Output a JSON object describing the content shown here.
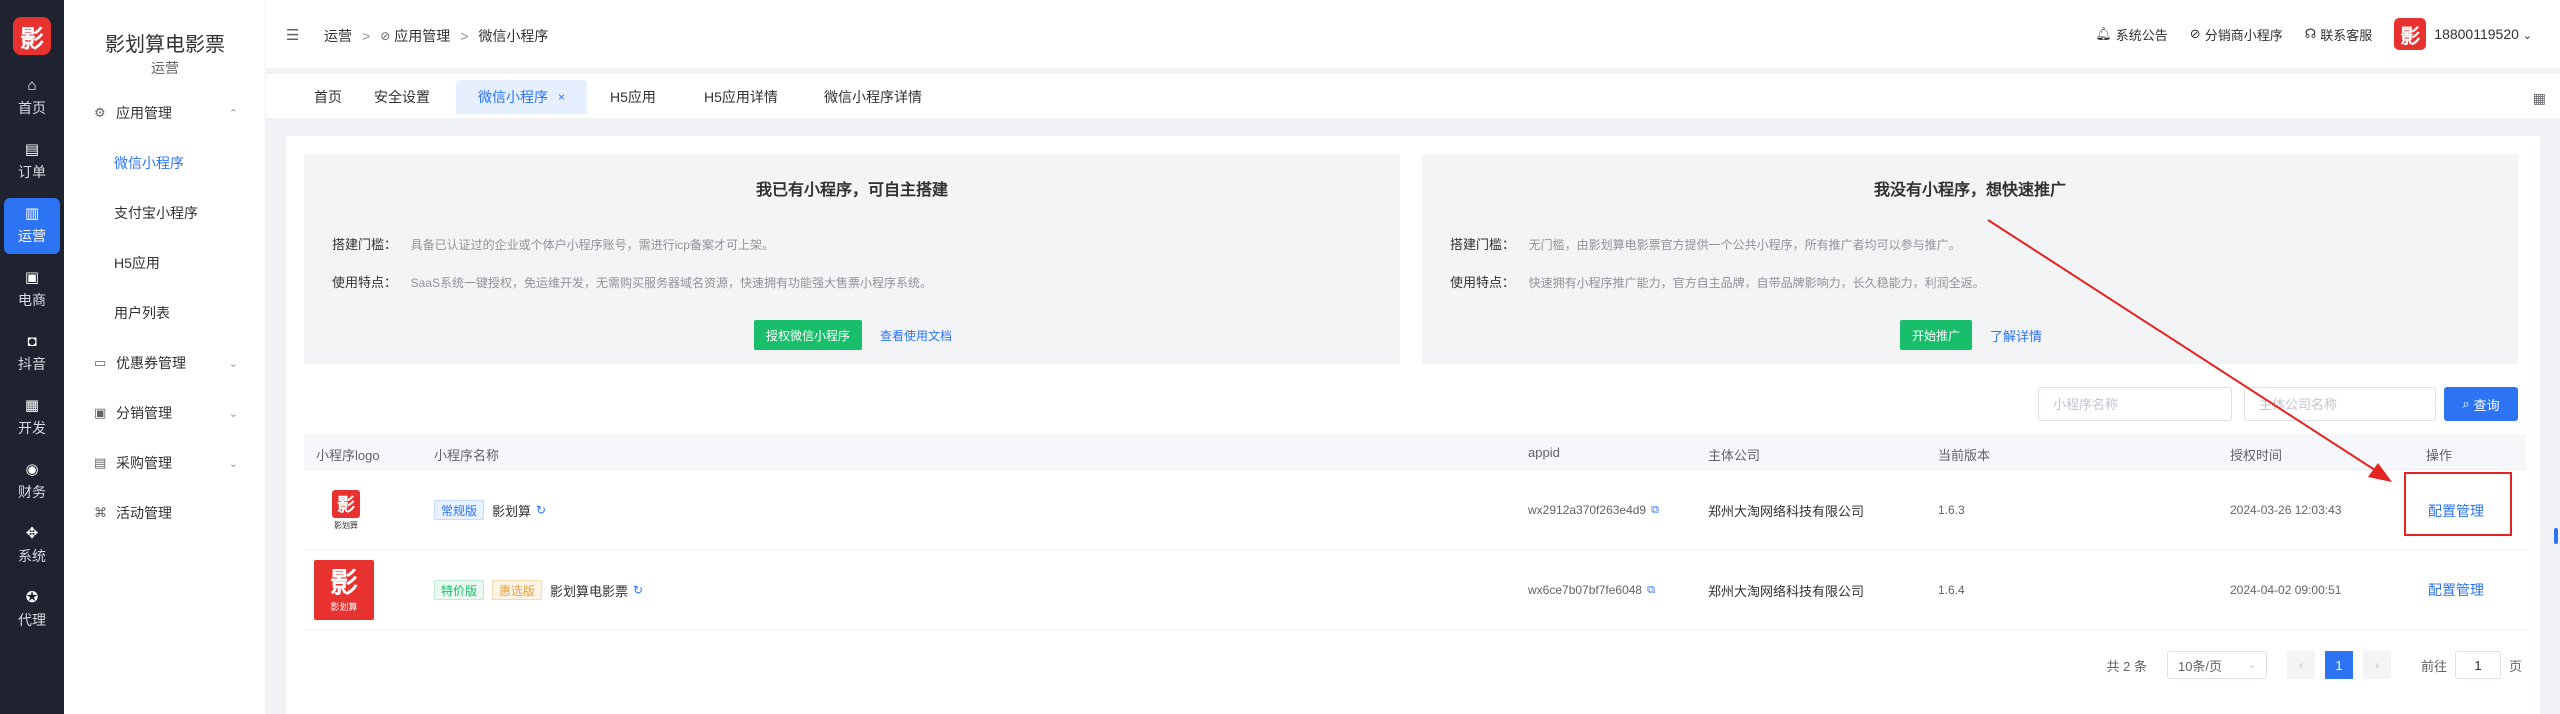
{
  "rail": {
    "logo": "影",
    "items": [
      {
        "label": "首页",
        "icon": "home-icon",
        "glyph": "⌂"
      },
      {
        "label": "订单",
        "icon": "order-icon",
        "glyph": "▤"
      },
      {
        "label": "运营",
        "icon": "chart-icon",
        "glyph": "▥"
      },
      {
        "label": "电商",
        "icon": "cart-icon",
        "glyph": "▣"
      },
      {
        "label": "抖音",
        "icon": "video-icon",
        "glyph": "◘"
      },
      {
        "label": "开发",
        "icon": "code-icon",
        "glyph": "▦"
      },
      {
        "label": "财务",
        "icon": "money-icon",
        "glyph": "◉"
      },
      {
        "label": "系统",
        "icon": "apps-icon",
        "glyph": "✥"
      },
      {
        "label": "代理",
        "icon": "agent-icon",
        "glyph": "✪"
      }
    ]
  },
  "sidebar": {
    "brand": "影划算电影票",
    "subtitle": "运营",
    "groups": {
      "app_manage": "应用管理",
      "coupon": "优惠券管理",
      "distribution": "分销管理",
      "purchase": "采购管理",
      "activity": "活动管理"
    },
    "subs": {
      "wechat": "微信小程序",
      "alipay": "支付宝小程序",
      "h5": "H5应用",
      "users": "用户列表"
    }
  },
  "header": {
    "breadcrumb": [
      "运营",
      "应用管理",
      "微信小程序"
    ],
    "links": {
      "notice": "系统公告",
      "dist_mini": "分销商小程序",
      "support": "联系客服"
    },
    "avatar": "影",
    "user": "18800119520"
  },
  "tabs": [
    "首页",
    "安全设置",
    "微信小程序",
    "H5应用",
    "H5应用详情",
    "微信小程序详情"
  ],
  "cards": {
    "left": {
      "title": "我已有小程序，可自主搭建",
      "threshold_label": "搭建门槛：",
      "threshold_text": "具备已认证过的企业或个体户小程序账号，需进行icp备案才可上架。",
      "feature_label": "使用特点：",
      "feature_text": "SaaS系统一键授权，免运维开发，无需购买服务器域名资源，快速拥有功能强大售票小程序系统。",
      "button": "授权微信小程序",
      "link": "查看使用文档"
    },
    "right": {
      "title": "我没有小程序，想快速推广",
      "threshold_label": "搭建门槛：",
      "threshold_text": "无门槛，由影划算电影票官方提供一个公共小程序，所有推广者均可以参与推广。",
      "feature_label": "使用特点：",
      "feature_text": "快速拥有小程序推广能力，官方自主品牌，自带品牌影响力，长久稳能力，利润全返。",
      "button": "开始推广",
      "link": "了解详情"
    }
  },
  "filters": {
    "name_placeholder": "小程序名称",
    "company_placeholder": "主体公司名称",
    "search": "查询"
  },
  "table": {
    "columns": [
      "小程序logo",
      "小程序名称",
      "appid",
      "主体公司",
      "当前版本",
      "授权时间",
      "操作"
    ],
    "rows": [
      {
        "logo_glyph": "影",
        "logo_text": "影划算",
        "tags": [
          "常规版"
        ],
        "name": "影划算",
        "appid": "wx2912a370f263e4d9",
        "company": "郑州大淘网络科技有限公司",
        "version": "1.6.3",
        "time": "2024-03-26 12:03:43",
        "action": "配置管理"
      },
      {
        "logo_glyph": "影",
        "logo_text": "影划算",
        "tags": [
          "特价版",
          "惠选版"
        ],
        "name": "影划算电影票",
        "appid": "wx6ce7b07bf7fe6048",
        "company": "郑州大淘网络科技有限公司",
        "version": "1.6.4",
        "time": "2024-04-02 09:00:51",
        "action": "配置管理"
      }
    ]
  },
  "pager": {
    "total": "共 2 条",
    "page_size": "10条/页",
    "current": "1",
    "goto_label": "前往",
    "goto_value": "1",
    "page_unit": "页"
  },
  "colors": {
    "primary": "#2d74f5",
    "green": "#19be6b",
    "annotation": "#e52421",
    "brand_red": "#e8322f"
  }
}
